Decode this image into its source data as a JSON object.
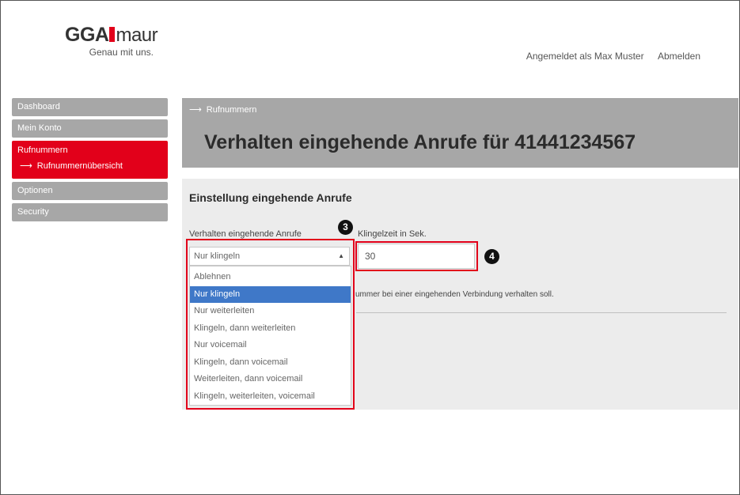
{
  "header": {
    "logo_brand": "GGA",
    "logo_suffix": "maur",
    "logo_tagline": "Genau mit uns.",
    "logged_in": "Angemeldet als Max Muster",
    "logout": "Abmelden"
  },
  "sidebar": {
    "items": [
      {
        "label": "Dashboard"
      },
      {
        "label": "Mein Konto"
      },
      {
        "label": "Rufnummern"
      },
      {
        "label": "Optionen"
      },
      {
        "label": "Security"
      }
    ],
    "sub_item": "Rufnummernübersicht"
  },
  "title_band": {
    "breadcrumb": "Rufnummern",
    "title": "Verhalten eingehende Anrufe für 41441234567"
  },
  "panel": {
    "section_title": "Einstellung eingehende Anrufe",
    "behavior_label": "Verhalten eingehende Anrufe",
    "ring_label": "Klingelzeit in Sek.",
    "selected_value": "Nur klingeln",
    "ring_value": "30",
    "hint": "ummer bei einer eingehenden Verbindung verhalten soll."
  },
  "dropdown": {
    "options": [
      "Ablehnen",
      "Nur klingeln",
      "Nur weiterleiten",
      "Klingeln, dann weiterleiten",
      "Nur voicemail",
      "Klingeln, dann voicemail",
      "Weiterleiten, dann voicemail",
      "Klingeln, weiterleiten, voicemail"
    ],
    "selected_index": 1
  },
  "callouts": {
    "a": "3",
    "b": "4"
  },
  "colors": {
    "brand_red": "#e2001a",
    "sidebar_grey": "#a7a7a7",
    "select_blue": "#3f78c8"
  }
}
